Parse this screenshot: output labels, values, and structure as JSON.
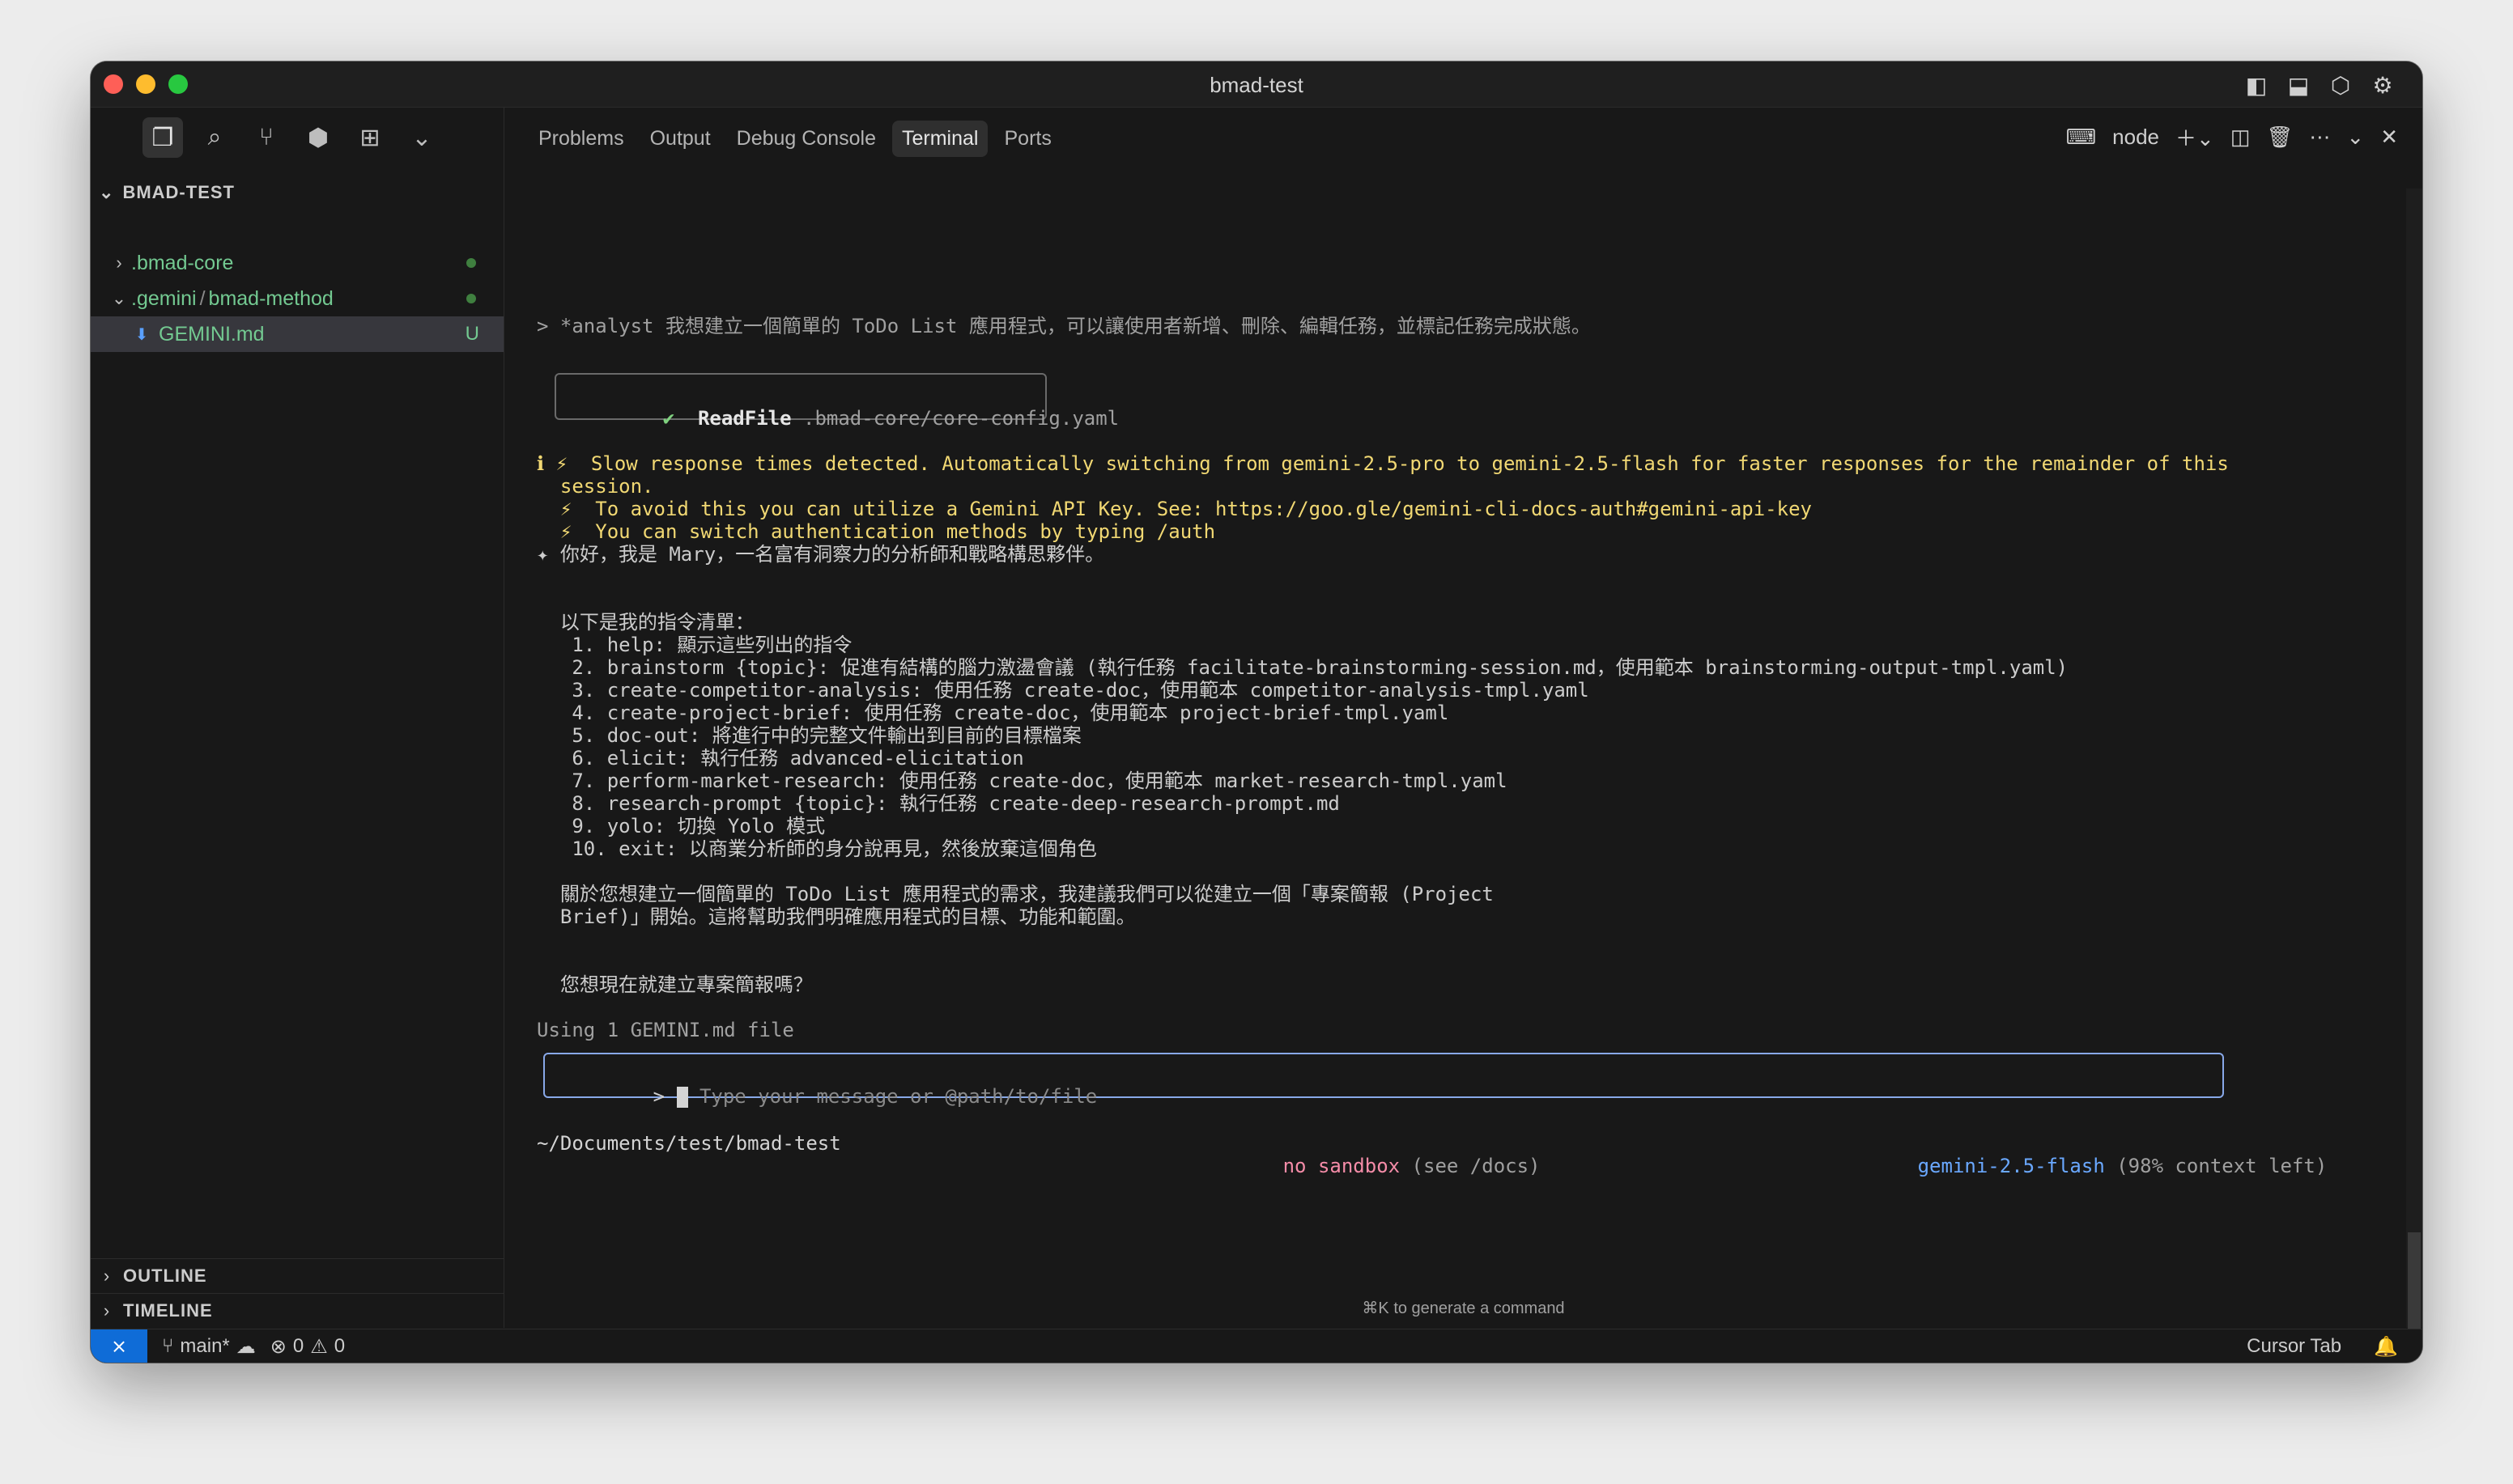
{
  "window": {
    "title": "bmad-test"
  },
  "sidebar": {
    "section_title": "BMAD-TEST",
    "items": [
      {
        "label": ".bmad-core"
      },
      {
        "label_part1": ".gemini",
        "separator": "/",
        "label_part2": "bmad-method"
      },
      {
        "label": "GEMINI.md",
        "badge": "U"
      }
    ],
    "outline": "OUTLINE",
    "timeline": "TIMELINE"
  },
  "panel": {
    "tabs": [
      "Problems",
      "Output",
      "Debug Console",
      "Terminal",
      "Ports"
    ],
    "active_tab": "Terminal",
    "terminal_name": "node"
  },
  "terminal": {
    "command_line": "> *analyst 我想建立一個簡單的 ToDo List 應用程式，可以讓使用者新增、刪除、編輯任務，並標記任務完成狀態。",
    "readfile": {
      "check": "✔",
      "label": "ReadFile",
      "path": ".bmad-core/core-config.yaml"
    },
    "warn1_a": "ℹ ⚡  Slow response times detected. Automatically switching from gemini-2.5-pro to gemini-2.5-flash for faster responses for the remainder of this",
    "warn1_b": "  session.",
    "warn2": "  ⚡  To avoid this you can utilize a Gemini API Key. See: https://goo.gle/gemini-cli-docs-auth#gemini-api-key",
    "warn3": "  ⚡  You can switch authentication methods by typing /auth",
    "greeting": "✦ 你好，我是 Mary，一名富有洞察力的分析師和戰略構思夥伴。",
    "list_title": "  以下是我的指令清單：",
    "commands": [
      "   1. help: 顯示這些列出的指令",
      "   2. brainstorm {topic}: 促進有結構的腦力激盪會議 (執行任務 facilitate-brainstorming-session.md，使用範本 brainstorming-output-tmpl.yaml)",
      "   3. create-competitor-analysis: 使用任務 create-doc，使用範本 competitor-analysis-tmpl.yaml",
      "   4. create-project-brief: 使用任務 create-doc，使用範本 project-brief-tmpl.yaml",
      "   5. doc-out: 將進行中的完整文件輸出到目前的目標檔案",
      "   6. elicit: 執行任務 advanced-elicitation",
      "   7. perform-market-research: 使用任務 create-doc，使用範本 market-research-tmpl.yaml",
      "   8. research-prompt {topic}: 執行任務 create-deep-research-prompt.md",
      "   9. yolo: 切換 Yolo 模式",
      "   10. exit: 以商業分析師的身分說再見，然後放棄這個角色"
    ],
    "suggest_1": "  關於您想建立一個簡單的 ToDo List 應用程式的需求，我建議我們可以從建立一個「專案簡報 (Project",
    "suggest_2": "  Brief)」開始。這將幫助我們明確應用程式的目標、功能和範圍。",
    "question": "  您想現在就建立專案簡報嗎？",
    "using_file": "Using 1 GEMINI.md file",
    "input_prompt": ">",
    "input_placeholder": "Type your message or @path/to/file",
    "cwd": "~/Documents/test/bmad-test",
    "sandbox": "no sandbox",
    "sandbox_hint": " (see /docs)",
    "model": "gemini-2.5-flash",
    "context": " (98% context left)",
    "hint": "⌘K to generate a command"
  },
  "status": {
    "branch": "main*",
    "errors": "0",
    "warnings": "0",
    "cursor_tab": "Cursor Tab"
  },
  "colors": {
    "accent": "#0f6cd7",
    "warning_text": "#f1d873",
    "git_added": "#73c991"
  }
}
